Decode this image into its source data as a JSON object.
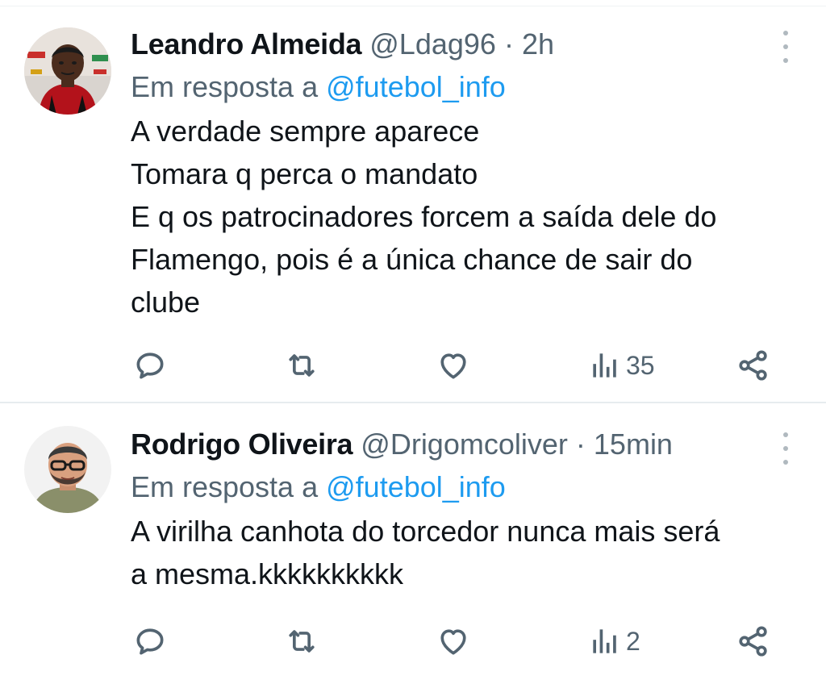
{
  "tweets": [
    {
      "name": "Leandro Almeida",
      "handle": "@Ldag96",
      "separator": "·",
      "time": "2h",
      "reply_prefix": "Em resposta a",
      "reply_to": "@futebol_info",
      "text_lines": [
        "A verdade sempre aparece",
        "Tomara q perca o mandato",
        "E q os patrocinadores forcem a saída dele do",
        "Flamengo, pois é a única chance de sair do",
        "clube"
      ],
      "views": "35"
    },
    {
      "name": "Rodrigo Oliveira",
      "handle": "@Drigomcoliver",
      "separator": "·",
      "time": "15min",
      "reply_prefix": "Em resposta a",
      "reply_to": "@futebol_info",
      "text_lines": [
        "A virilha canhota do torcedor nunca mais será",
        "a mesma.kkkkkkkkkk"
      ],
      "views": "2"
    }
  ],
  "icons": {
    "reply": "reply-icon",
    "retweet": "retweet-icon",
    "like": "heart-icon",
    "views": "views-icon",
    "share": "share-icon",
    "more": "more-icon"
  },
  "colors": {
    "text": "#0f1419",
    "secondary": "#536471",
    "mention": "#1d9bf0",
    "divider": "#e7ecef"
  }
}
